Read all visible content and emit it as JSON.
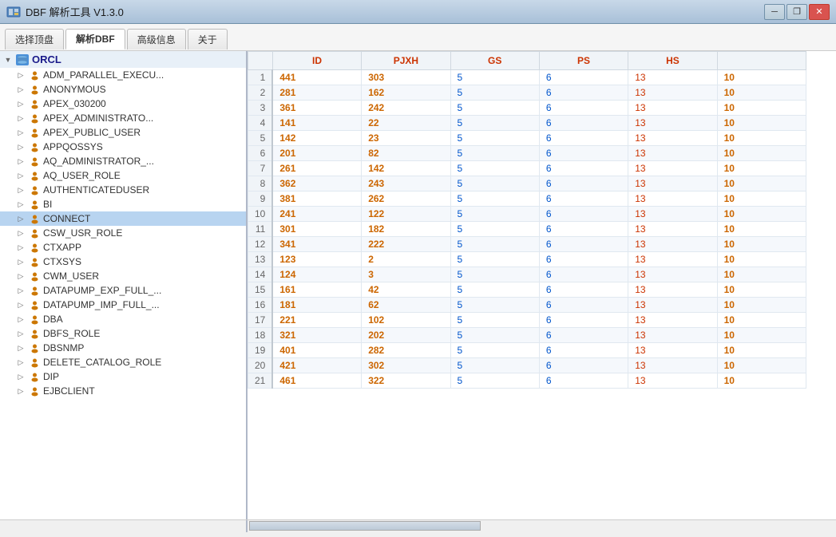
{
  "titleBar": {
    "title": "DBF 解析工具 V1.3.0",
    "minimizeLabel": "─",
    "restoreLabel": "❐",
    "closeLabel": "✕"
  },
  "menuBar": {
    "tabs": [
      {
        "label": "选择顶盘"
      },
      {
        "label": "解析DBF"
      },
      {
        "label": "高级信息"
      },
      {
        "label": "关于"
      }
    ]
  },
  "tree": {
    "rootLabel": "ORCL",
    "items": [
      {
        "label": "ADM_PARALLEL_EXECU..."
      },
      {
        "label": "ANONYMOUS"
      },
      {
        "label": "APEX_030200"
      },
      {
        "label": "APEX_ADMINISTRATO..."
      },
      {
        "label": "APEX_PUBLIC_USER"
      },
      {
        "label": "APPQOSSYS"
      },
      {
        "label": "AQ_ADMINISTRATOR_..."
      },
      {
        "label": "AQ_USER_ROLE"
      },
      {
        "label": "AUTHENTICATEDUSER"
      },
      {
        "label": "BI"
      },
      {
        "label": "CONNECT"
      },
      {
        "label": "CSW_USR_ROLE"
      },
      {
        "label": "CTXAPP"
      },
      {
        "label": "CTXSYS"
      },
      {
        "label": "CWM_USER"
      },
      {
        "label": "DATAPUMP_EXP_FULL_..."
      },
      {
        "label": "DATAPUMP_IMP_FULL_..."
      },
      {
        "label": "DBA"
      },
      {
        "label": "DBFS_ROLE"
      },
      {
        "label": "DBSNMP"
      },
      {
        "label": "DELETE_CATALOG_ROLE"
      },
      {
        "label": "DIP"
      },
      {
        "label": "EJBCLIENT"
      }
    ]
  },
  "table": {
    "columns": [
      "ID",
      "PJXH",
      "GS",
      "PS",
      "HS"
    ],
    "rows": [
      {
        "num": 1,
        "id": 441,
        "pjxh": 303,
        "gs": 5,
        "ps": 6,
        "hs": 13,
        "extra": 10
      },
      {
        "num": 2,
        "id": 281,
        "pjxh": 162,
        "gs": 5,
        "ps": 6,
        "hs": 13,
        "extra": 10
      },
      {
        "num": 3,
        "id": 361,
        "pjxh": 242,
        "gs": 5,
        "ps": 6,
        "hs": 13,
        "extra": 10
      },
      {
        "num": 4,
        "id": 141,
        "pjxh": 22,
        "gs": 5,
        "ps": 6,
        "hs": 13,
        "extra": 10
      },
      {
        "num": 5,
        "id": 142,
        "pjxh": 23,
        "gs": 5,
        "ps": 6,
        "hs": 13,
        "extra": 10
      },
      {
        "num": 6,
        "id": 201,
        "pjxh": 82,
        "gs": 5,
        "ps": 6,
        "hs": 13,
        "extra": 10
      },
      {
        "num": 7,
        "id": 261,
        "pjxh": 142,
        "gs": 5,
        "ps": 6,
        "hs": 13,
        "extra": 10
      },
      {
        "num": 8,
        "id": 362,
        "pjxh": 243,
        "gs": 5,
        "ps": 6,
        "hs": 13,
        "extra": 10
      },
      {
        "num": 9,
        "id": 381,
        "pjxh": 262,
        "gs": 5,
        "ps": 6,
        "hs": 13,
        "extra": 10
      },
      {
        "num": 10,
        "id": 241,
        "pjxh": 122,
        "gs": 5,
        "ps": 6,
        "hs": 13,
        "extra": 10
      },
      {
        "num": 11,
        "id": 301,
        "pjxh": 182,
        "gs": 5,
        "ps": 6,
        "hs": 13,
        "extra": 10
      },
      {
        "num": 12,
        "id": 341,
        "pjxh": 222,
        "gs": 5,
        "ps": 6,
        "hs": 13,
        "extra": 10
      },
      {
        "num": 13,
        "id": 123,
        "pjxh": 2,
        "gs": 5,
        "ps": 6,
        "hs": 13,
        "extra": 10
      },
      {
        "num": 14,
        "id": 124,
        "pjxh": 3,
        "gs": 5,
        "ps": 6,
        "hs": 13,
        "extra": 10
      },
      {
        "num": 15,
        "id": 161,
        "pjxh": 42,
        "gs": 5,
        "ps": 6,
        "hs": 13,
        "extra": 10
      },
      {
        "num": 16,
        "id": 181,
        "pjxh": 62,
        "gs": 5,
        "ps": 6,
        "hs": 13,
        "extra": 10
      },
      {
        "num": 17,
        "id": 221,
        "pjxh": 102,
        "gs": 5,
        "ps": 6,
        "hs": 13,
        "extra": 10
      },
      {
        "num": 18,
        "id": 321,
        "pjxh": 202,
        "gs": 5,
        "ps": 6,
        "hs": 13,
        "extra": 10
      },
      {
        "num": 19,
        "id": 401,
        "pjxh": 282,
        "gs": 5,
        "ps": 6,
        "hs": 13,
        "extra": 10
      },
      {
        "num": 20,
        "id": 421,
        "pjxh": 302,
        "gs": 5,
        "ps": 6,
        "hs": 13,
        "extra": 10
      },
      {
        "num": 21,
        "id": 461,
        "pjxh": 322,
        "gs": 5,
        "ps": 6,
        "hs": 13,
        "extra": 10
      }
    ]
  }
}
